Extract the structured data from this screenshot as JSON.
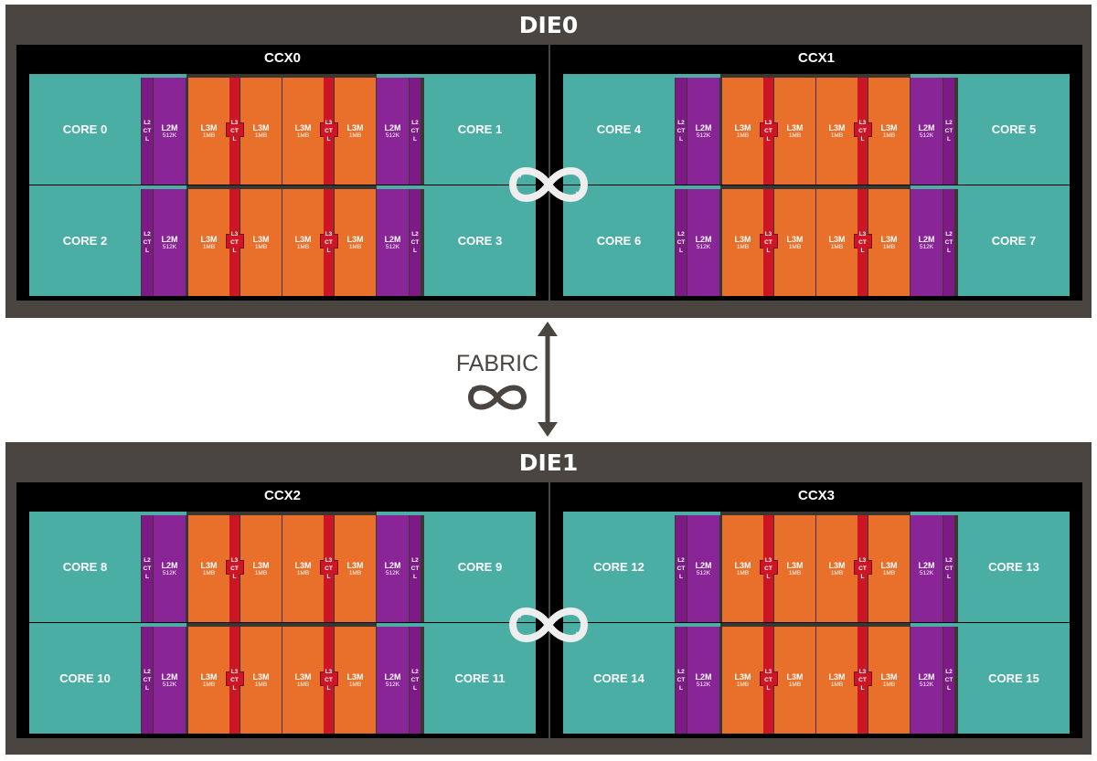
{
  "dies": [
    {
      "title": "DIE0",
      "ccxs": [
        {
          "title": "CCX0",
          "cores": [
            "CORE 0",
            "CORE 1",
            "CORE 2",
            "CORE 3"
          ]
        },
        {
          "title": "CCX1",
          "cores": [
            "CORE 4",
            "CORE 5",
            "CORE 6",
            "CORE 7"
          ]
        }
      ]
    },
    {
      "title": "DIE1",
      "ccxs": [
        {
          "title": "CCX2",
          "cores": [
            "CORE 8",
            "CORE 9",
            "CORE 10",
            "CORE 11"
          ]
        },
        {
          "title": "CCX3",
          "cores": [
            "CORE 12",
            "CORE 13",
            "CORE 14",
            "CORE 15"
          ]
        }
      ]
    }
  ],
  "labels": {
    "l2ctl": "L2CTL",
    "l3ctl": "L3CTL",
    "l2m": "L2M",
    "l2m_size": "512K",
    "l3m": "L3M",
    "l3m_size": "1MB"
  },
  "fabric": {
    "label": "FABRIC"
  },
  "colors": {
    "die_bg": "#4a4540",
    "ccx_bg": "#000000",
    "core": "#4aaea5",
    "l2": "#8a2597",
    "l3": "#e8702a",
    "l3ctl": "#cc1626"
  }
}
